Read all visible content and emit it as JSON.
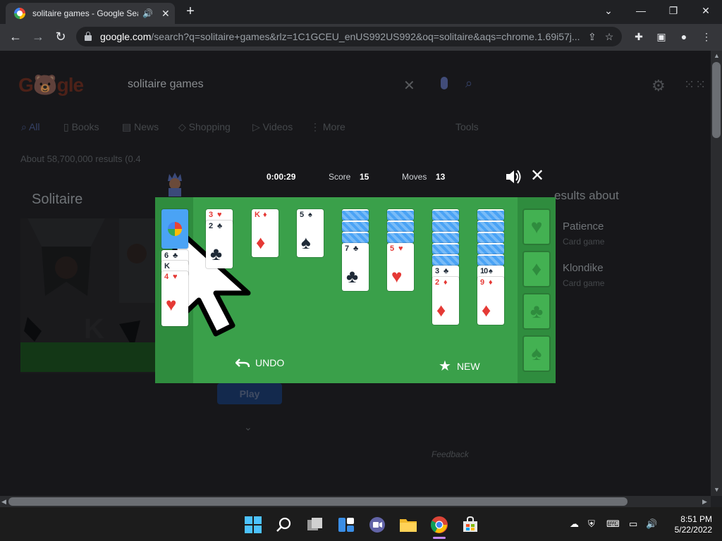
{
  "browser": {
    "tab_title": "solitaire games - Google Sea",
    "url_host": "google.com",
    "url_rest": "/search?q=solitaire+games&rlz=1C1GCEU_enUS992US992&oq=solitaire&aqs=chrome.1.69i57j..."
  },
  "search": {
    "query": "solitaire games",
    "tabs": [
      "All",
      "Books",
      "News",
      "Shopping",
      "Videos",
      "More"
    ],
    "tools": "Tools",
    "result_count": "About 58,700,000 results (0.4",
    "solitaire_heading": "Solitaire",
    "play_label": "Play",
    "feedback": "Feedback",
    "kp_title": "esults about",
    "kp_items": [
      {
        "name": "Patience",
        "sub": "Card game"
      },
      {
        "name": "Klondike",
        "sub": "Card game"
      }
    ]
  },
  "game": {
    "time": "0:00:29",
    "score_label": "Score",
    "score": "15",
    "moves_label": "Moves",
    "moves": "13",
    "undo_label": "UNDO",
    "new_label": "NEW",
    "stock_cards": [
      {
        "rank": "6",
        "suit": "♣",
        "color": "blk"
      },
      {
        "rank": "K",
        "suit": "",
        "color": "blk"
      },
      {
        "rank": "4",
        "suit": "♥",
        "color": "red"
      }
    ],
    "columns": [
      {
        "hidden": 0,
        "cards": [
          {
            "rank": "3",
            "suit": "♥",
            "color": "red"
          },
          {
            "rank": "2",
            "suit": "♣",
            "color": "blk"
          }
        ]
      },
      {
        "hidden": 0,
        "cards": [
          {
            "rank": "K",
            "suit": "♦",
            "color": "red"
          }
        ]
      },
      {
        "hidden": 0,
        "cards": [
          {
            "rank": "5",
            "suit": "♠",
            "color": "blk"
          }
        ]
      },
      {
        "hidden": 3,
        "cards": [
          {
            "rank": "7",
            "suit": "♣",
            "color": "blk"
          }
        ]
      },
      {
        "hidden": 3,
        "cards": [
          {
            "rank": "5",
            "suit": "♥",
            "color": "red"
          }
        ]
      },
      {
        "hidden": 5,
        "cards": [
          {
            "rank": "3",
            "suit": "♣",
            "color": "blk"
          },
          {
            "rank": "2",
            "suit": "♦",
            "color": "red"
          }
        ]
      },
      {
        "hidden": 5,
        "cards": [
          {
            "rank": "10",
            "suit": "♠",
            "color": "blk"
          },
          {
            "rank": "9",
            "suit": "♦",
            "color": "red"
          }
        ]
      }
    ],
    "foundations": [
      "♥",
      "♦",
      "♣",
      "♠"
    ]
  },
  "taskbar": {
    "time": "8:51 PM",
    "date": "5/22/2022"
  }
}
